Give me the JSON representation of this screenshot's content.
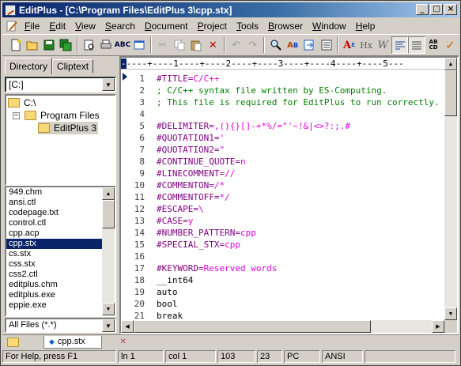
{
  "window": {
    "title": "EditPlus - [C:\\Program Files\\EditPlus 3\\cpp.stx]"
  },
  "menu": [
    "File",
    "Edit",
    "View",
    "Search",
    "Document",
    "Project",
    "Tools",
    "Browser",
    "Window",
    "Help"
  ],
  "sidebar": {
    "tabs": [
      "Directory",
      "Cliptext"
    ],
    "drive": "[C:]",
    "tree": [
      "C:\\",
      "Program Files",
      "EditPlus 3"
    ],
    "files": [
      "949.chm",
      "ansi.ctl",
      "codepage.txt",
      "control.ctl",
      "cpp.acp",
      "cpp.stx",
      "cs.stx",
      "css.stx",
      "css2.ctl",
      "editplus.chm",
      "editplus.exe",
      "eppie.exe"
    ],
    "selected_file": "cpp.stx",
    "filter": "All Files (*.*)"
  },
  "editor": {
    "ruler": "----+----1----+----2----+----3----+----4----+----5---",
    "line_numbers": [
      "1",
      "2",
      "3",
      "4",
      "5",
      "6",
      "7",
      "8",
      "9",
      "10",
      "11",
      "12",
      "13",
      "14",
      "15",
      "16",
      "17",
      "18",
      "19",
      "20",
      "21"
    ],
    "lines": [
      {
        "k": "#TITLE=",
        "v": "C/C++",
        "s": "dir"
      },
      {
        "t": "; C/C++ syntax file written by ES-Computing.",
        "s": "cmt"
      },
      {
        "t": "; This file is required for EditPlus to run correctly.",
        "s": "cmt"
      },
      {
        "t": "",
        "s": "txt"
      },
      {
        "k": "#DELIMITER=",
        "v": ",(){}[]-+*%/=\"'~!&|<>?:;.#",
        "s": "dir"
      },
      {
        "k": "#QUOTATION1=",
        "v": "'",
        "s": "dir"
      },
      {
        "k": "#QUOTATION2=",
        "v": "\"",
        "s": "dir"
      },
      {
        "k": "#CONTINUE_QUOTE=",
        "v": "n",
        "s": "dir"
      },
      {
        "k": "#LINECOMMENT=",
        "v": "//",
        "s": "dir"
      },
      {
        "k": "#COMMENTON=",
        "v": "/*",
        "s": "dir"
      },
      {
        "k": "#COMMENTOFF=",
        "v": "*/",
        "s": "dir"
      },
      {
        "k": "#ESCAPE=",
        "v": "\\",
        "s": "dir"
      },
      {
        "k": "#CASE=",
        "v": "y",
        "s": "dir"
      },
      {
        "k": "#NUMBER_PATTERN=",
        "v": "cpp",
        "s": "dir"
      },
      {
        "k": "#SPECIAL_STX=",
        "v": "cpp",
        "s": "dir"
      },
      {
        "t": "",
        "s": "txt"
      },
      {
        "k": "#KEYWORD=",
        "v": "Reserved words",
        "s": "dir"
      },
      {
        "t": "__int64",
        "s": "txt"
      },
      {
        "t": "auto",
        "s": "txt"
      },
      {
        "t": "bool",
        "s": "txt"
      },
      {
        "t": "break",
        "s": "txt"
      }
    ]
  },
  "doc_tab": "cpp.stx",
  "status": {
    "help": "For Help, press F1",
    "line": "ln 1",
    "col": "col 1",
    "lines": "103",
    "n": "23",
    "mode": "PC",
    "encoding": "ANSI"
  },
  "colors": {
    "directive": "#800080",
    "value": "#e000e0",
    "comment": "#008000",
    "selection": "#0a246a"
  }
}
